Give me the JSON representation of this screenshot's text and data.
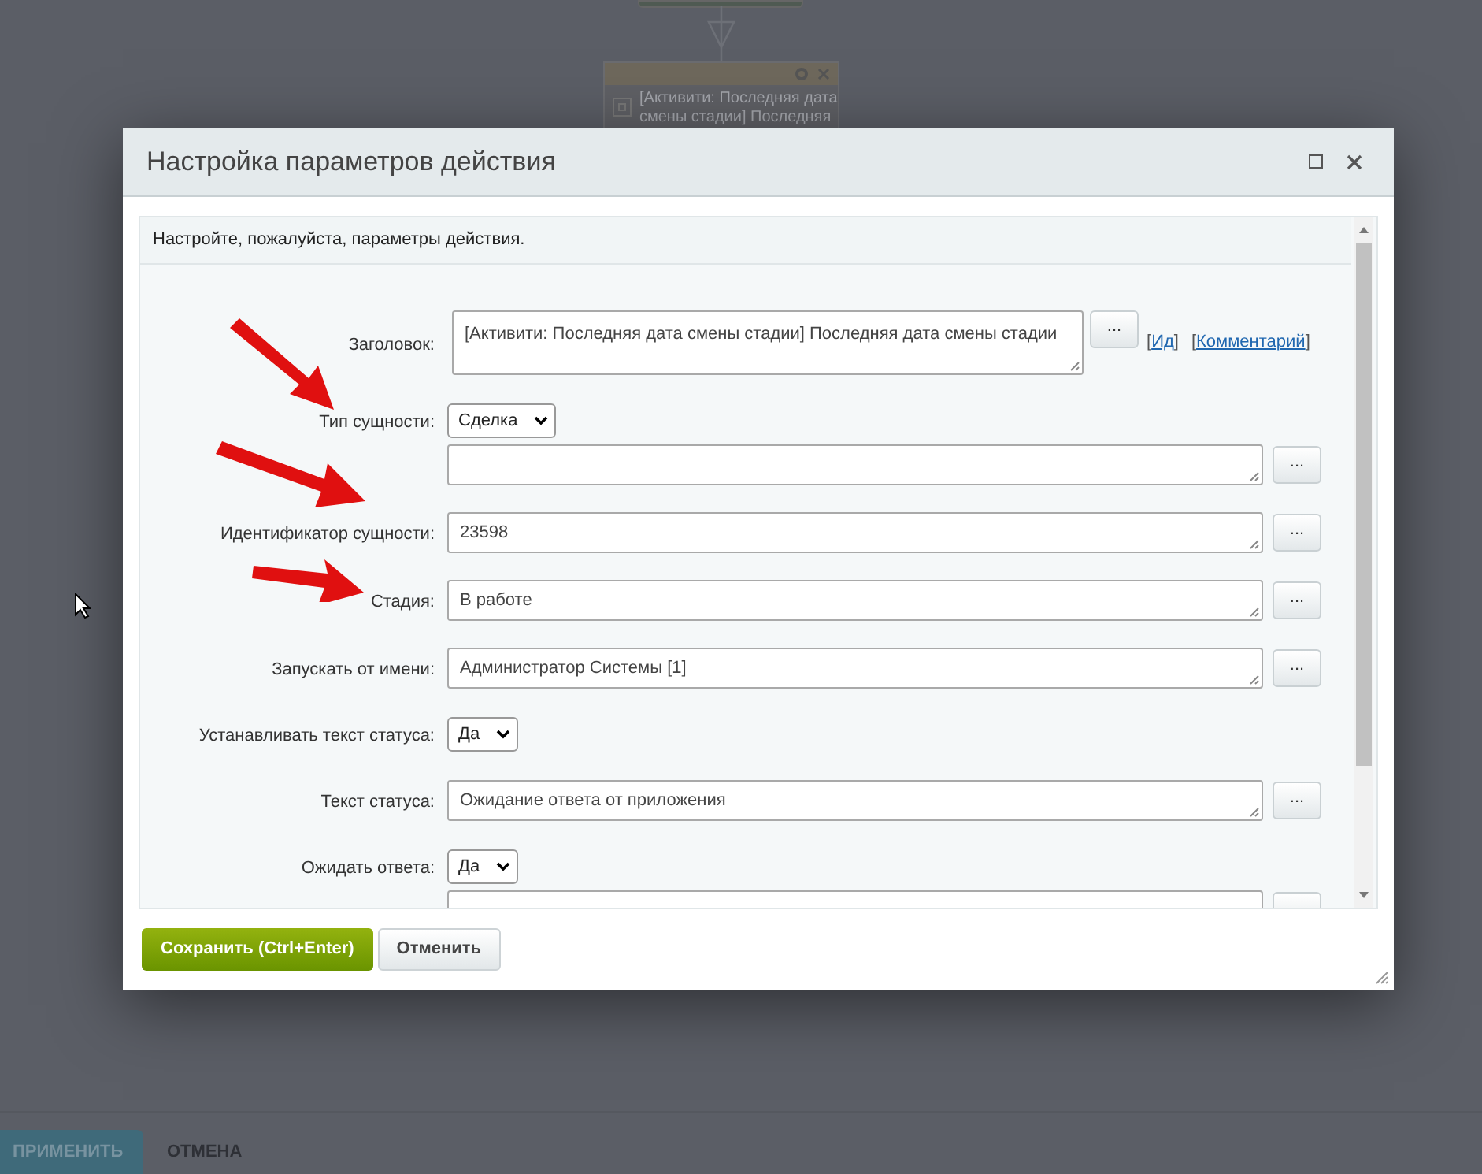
{
  "background": {
    "activity_card": {
      "text": "[Активити: Последняя дата смены стадии] Последняя"
    },
    "buttons": [
      {
        "label": "ПРИМЕНИТЬ",
        "kind": "primary"
      },
      {
        "label": "ОТМЕНА",
        "kind": "plain"
      }
    ]
  },
  "dialog": {
    "title": "Настройка параметров действия",
    "description": "Настройте, пожалуйста, параметры действия.",
    "fields": [
      {
        "kind": "textarea",
        "label": "Заголовок:",
        "value": "[Активити: Последняя дата смены стадии] Последняя дата смены стадии",
        "links": [
          "Ид",
          "Комментарий"
        ]
      },
      {
        "kind": "select",
        "label": "Тип сущности:",
        "value": "Сделка"
      },
      {
        "kind": "textarea"
      },
      {
        "kind": "textarea",
        "label": "Идентификатор сущности:",
        "value": "23598"
      },
      {
        "kind": "textarea",
        "label": "Стадия:",
        "value": "В работе"
      },
      {
        "kind": "textarea",
        "label": "Запускать от имени:",
        "value": "Администратор Системы [1]"
      },
      {
        "kind": "select",
        "label": "Устанавливать текст статуса:",
        "value": "Да"
      },
      {
        "kind": "textarea",
        "label": "Текст статуса:",
        "value": "Ожидание ответа от приложения"
      },
      {
        "kind": "select",
        "label": "Ожидать ответа:",
        "value": "Да"
      },
      {
        "kind": "textarea"
      }
    ],
    "button_label": "...",
    "bracket_open": "[",
    "bracket_close": "]",
    "buttons": [
      {
        "label": "Сохранить (Ctrl+Enter)",
        "kind": "primary"
      },
      {
        "label": "Отменить",
        "kind": "secondary"
      }
    ]
  }
}
